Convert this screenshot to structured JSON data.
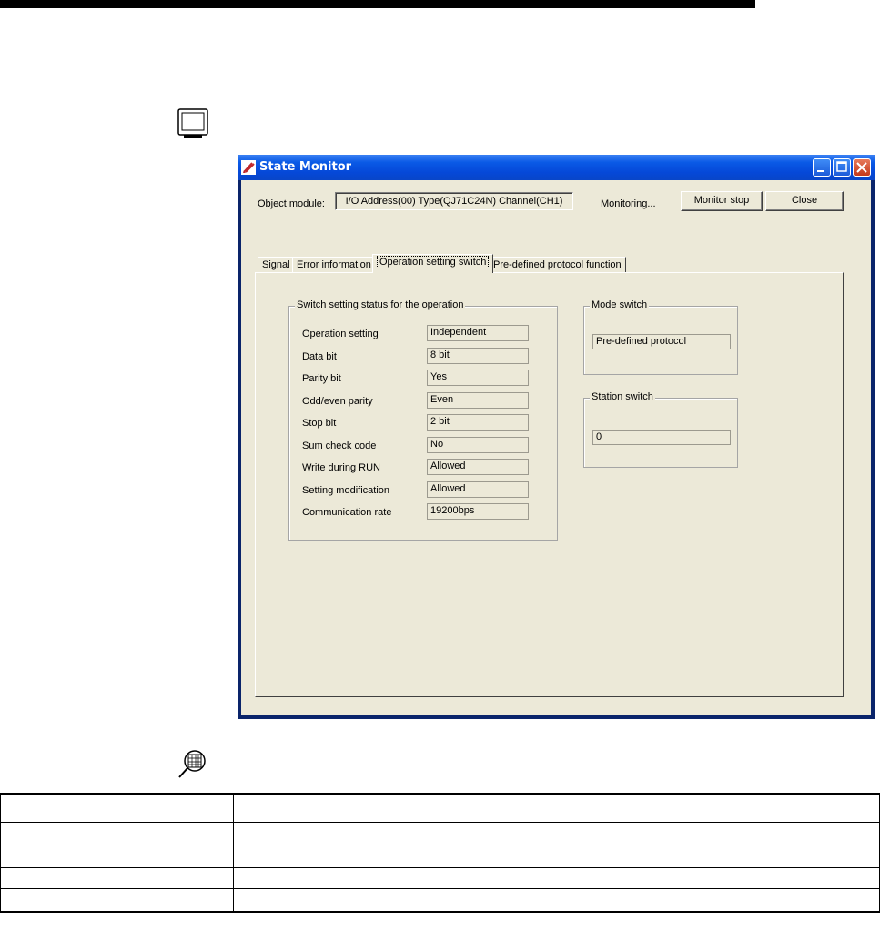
{
  "window": {
    "title": "State Monitor"
  },
  "header": {
    "object_module_label": "Object module:",
    "object_module_value": "I/O Address(00) Type(QJ71C24N) Channel(CH1)",
    "monitoring_status": "Monitoring...",
    "monitor_stop_label": "Monitor stop",
    "close_label": "Close"
  },
  "tabs": [
    {
      "label": "Signal",
      "active": false
    },
    {
      "label": "Error information",
      "active": false
    },
    {
      "label": "Operation setting switch",
      "active": true
    },
    {
      "label": "Pre-defined protocol function",
      "active": false
    }
  ],
  "switch_group": {
    "title": "Switch setting status for the operation",
    "rows": [
      {
        "label": "Operation setting",
        "value": "Independent"
      },
      {
        "label": "Data bit",
        "value": "8 bit"
      },
      {
        "label": "Parity bit",
        "value": "Yes"
      },
      {
        "label": "Odd/even parity",
        "value": "Even"
      },
      {
        "label": "Stop bit",
        "value": "2 bit"
      },
      {
        "label": "Sum check code",
        "value": "No"
      },
      {
        "label": "Write during RUN",
        "value": "Allowed"
      },
      {
        "label": "Setting modification",
        "value": "Allowed"
      },
      {
        "label": "Communication rate",
        "value": "19200bps"
      }
    ]
  },
  "mode_switch": {
    "title": "Mode switch",
    "value": "Pre-defined protocol"
  },
  "station_switch": {
    "title": "Station switch",
    "value": "0"
  },
  "icons": {
    "page_top": "monitor-icon",
    "page_bottom": "magnifier-table-icon"
  }
}
